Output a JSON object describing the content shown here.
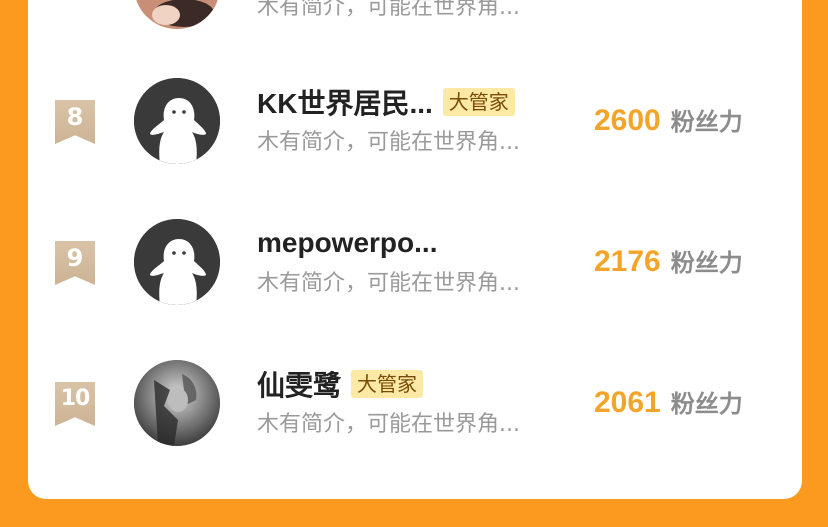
{
  "rows": [
    {
      "rank": "",
      "name": "",
      "badge": "",
      "intro": "木有简介，可能在世界角...",
      "fans": "",
      "fans_label": ""
    },
    {
      "rank": "8",
      "name": "KK世界居民...",
      "badge": "大管家",
      "intro": "木有简介，可能在世界角...",
      "fans": "2600",
      "fans_label": "粉丝力"
    },
    {
      "rank": "9",
      "name": "mepowerpo...",
      "badge": "",
      "intro": "木有简介，可能在世界角...",
      "fans": "2176",
      "fans_label": "粉丝力"
    },
    {
      "rank": "10",
      "name": "仙雯鹭",
      "badge": "大管家",
      "intro": "木有简介，可能在世界角...",
      "fans": "2061",
      "fans_label": "粉丝力"
    }
  ],
  "colors": {
    "background": "#fb9a1e",
    "fans_number": "#f3a529",
    "badge_bg": "#fde9a6",
    "rank_flag": "#d9c3a7"
  },
  "icons": {
    "default_avatar": "ghost-avatar-icon",
    "photo_avatar": "user-photo-avatar"
  }
}
